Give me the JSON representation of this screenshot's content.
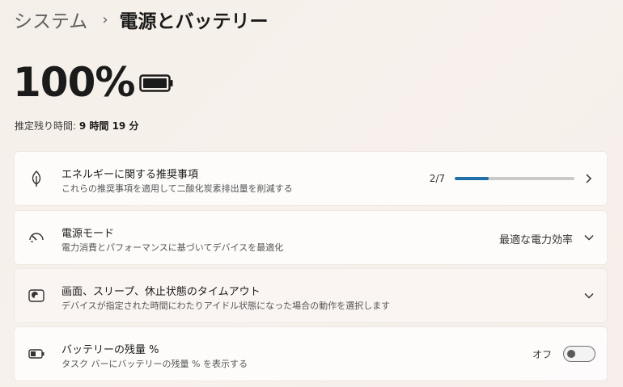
{
  "breadcrumb": {
    "parent": "システム",
    "separator": "›",
    "current": "電源とバッテリー"
  },
  "battery": {
    "percent": "100%",
    "remaining_label": "推定残り時間:",
    "remaining_value": "9 時間 19 分"
  },
  "cards": {
    "energy": {
      "title": "エネルギーに関する推奨事項",
      "desc": "これらの推奨事項を適用して二酸化炭素排出量を削減する",
      "progress_text": "2/7",
      "progress_fraction": 0.285
    },
    "power_mode": {
      "title": "電源モード",
      "desc": "電力消費とパフォーマンスに基づいてデバイスを最適化",
      "value": "最適な電力効率"
    },
    "screen_sleep": {
      "title": "画面、スリープ、休止状態のタイムアウト",
      "desc": "デバイスが指定された時間にわたりアイドル状態になった場合の動作を選択します"
    },
    "battery_percent": {
      "title": "バッテリーの残量 %",
      "desc": "タスク バーにバッテリーの残量 % を表示する",
      "toggle_label": "オフ",
      "toggle_on": false
    }
  },
  "colors": {
    "accent": "#1f6fa8",
    "text": "#1b1b1b"
  }
}
